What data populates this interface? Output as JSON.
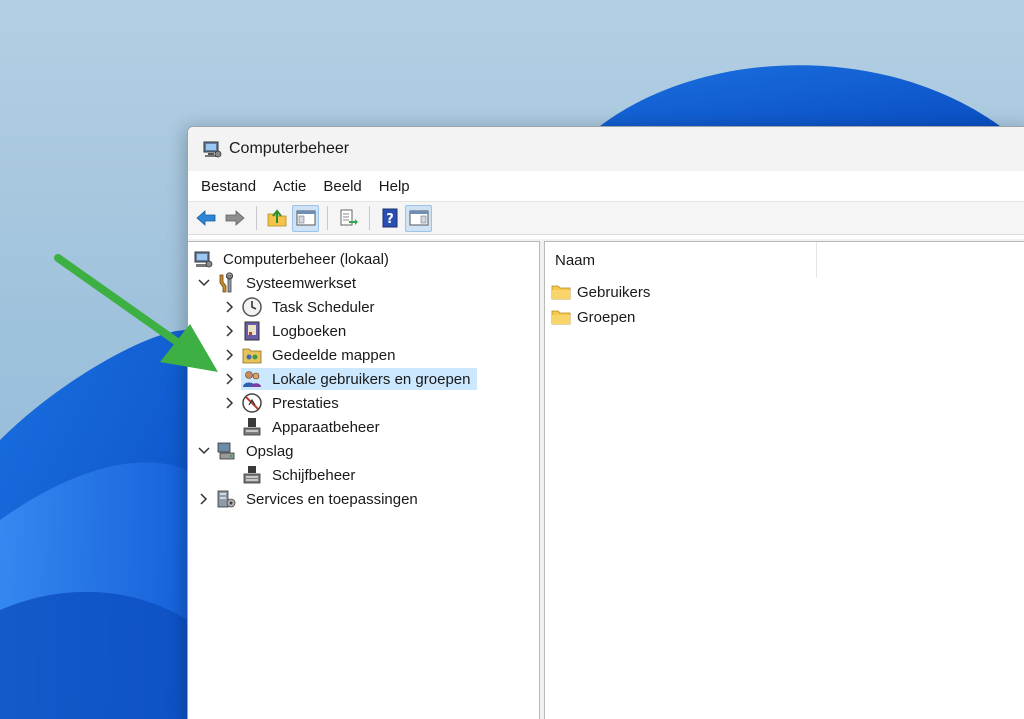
{
  "window": {
    "title": "Computerbeheer",
    "icon": "computer-management-icon"
  },
  "menubar": {
    "items": [
      "Bestand",
      "Actie",
      "Beeld",
      "Help"
    ]
  },
  "toolbar": {
    "buttons": [
      "back-arrow-icon",
      "forward-arrow-icon",
      "up-folder-icon",
      "show-hide-console-tree-icon",
      "export-list-icon",
      "help-icon",
      "show-hide-action-pane-icon"
    ]
  },
  "tree": {
    "root": "Computerbeheer (lokaal)",
    "systeemwerkset": "Systeemwerkset",
    "task_scheduler": "Task Scheduler",
    "logboeken": "Logboeken",
    "gedeelde_mappen": "Gedeelde mappen",
    "lokale_gebruikers": "Lokale gebruikers en groepen",
    "prestaties": "Prestaties",
    "apparaatbeheer": "Apparaatbeheer",
    "opslag": "Opslag",
    "schijfbeheer": "Schijfbeheer",
    "services": "Services en toepassingen",
    "selected": "Lokale gebruikers en groepen"
  },
  "list": {
    "column_name": "Naam",
    "items": [
      "Gebruikers",
      "Groepen"
    ]
  },
  "colors": {
    "selection": "#cce8ff",
    "arrow": "#3cb043",
    "folder": "#f6c94e"
  }
}
